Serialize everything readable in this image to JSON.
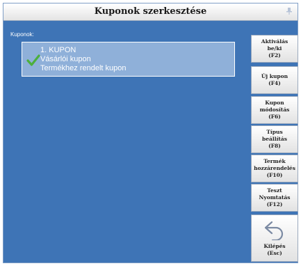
{
  "window": {
    "title": "Kuponok szerkesztése"
  },
  "list": {
    "label": "Kuponok:",
    "items": [
      {
        "line1": "1. KUPON",
        "line2": "Vásárlói kupon",
        "line3": "Termékhez rendelt kupon",
        "icon": "checkmark-icon"
      }
    ]
  },
  "sidebar": {
    "buttons": [
      {
        "label": "Aktiválás\nbe/ki\n(F2)"
      },
      {
        "label": "Új kupon\n(F4)"
      },
      {
        "label": "Kupon\nmódosítás\n(F6)"
      },
      {
        "label": "Típus\nbeállítás\n(F8)"
      },
      {
        "label": "Termék\nhozzárendelés\n(F10)"
      },
      {
        "label": "Teszt\nNyomtatás\n(F12)"
      }
    ],
    "exit": {
      "label": "Kilépés\n(Esc)",
      "icon": "undo-arrow-icon"
    }
  },
  "colors": {
    "background": "#3e74b6",
    "item_background": "#8fb0d9",
    "check": "#4caf3c"
  }
}
